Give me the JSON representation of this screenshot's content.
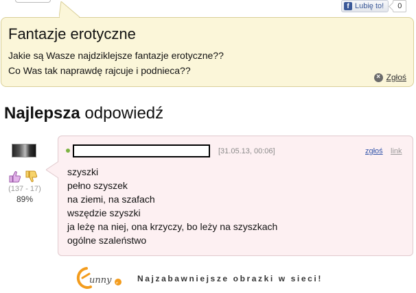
{
  "like_widget": {
    "label": "Lubię to!",
    "count": "0",
    "icon": "facebook-icon",
    "brand_color": "#3b5998"
  },
  "question": {
    "title": "Fantazje erotyczne",
    "lines": [
      "Jakie są Wasze najdziklejsze fantazje erotyczne??",
      "Co Was tak naprawdę rajcuje i podnieca??"
    ],
    "report_label": "Zgłoś",
    "report_icon": "close-circle-icon",
    "background": "#fbf6d9"
  },
  "best_answer": {
    "heading_bold": "Najlepsza",
    "heading_rest": " odpowiedź",
    "votes": {
      "up_icon": "thumbs-up-icon",
      "down_icon": "thumbs-down-icon",
      "stats": "(137 - 17)",
      "percent": "89%"
    },
    "answer": {
      "date": "[31.05.13, 00:06]",
      "report_label": "zgłoś",
      "link_label": "link",
      "lines": [
        "szyszki",
        "pełno szyszek",
        "na ziemi, na szafach",
        "wszędzie szyszki",
        "ja leżę na niej, ona krzyczy, bo leży na szyszkach",
        "ogólne szaleństwo"
      ],
      "background": "#fdf0f2",
      "status_color": "#7cb342"
    }
  },
  "footer": {
    "logo_text": "funny.pl",
    "tagline": "Najzabawniejsze obrazki w sieci!"
  }
}
